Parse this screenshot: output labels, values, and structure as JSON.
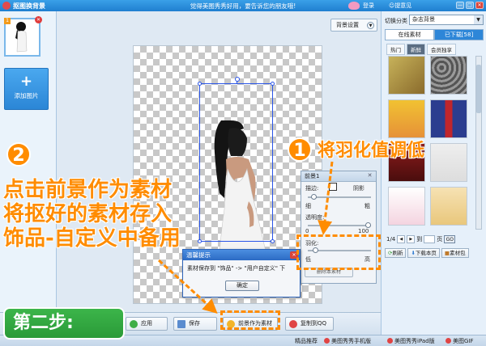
{
  "window": {
    "title": "抠图换背景",
    "slogan": "觉得美图秀秀好用，要告诉您的朋友哦!",
    "login": "登录",
    "about": "提意见",
    "min": "—",
    "max": "□",
    "close": "✕"
  },
  "left_panel": {
    "thumb_index": "1",
    "thumb_delete": "✕",
    "add_icon": "+",
    "add_label": "添加图片"
  },
  "canvas_toolbar": {
    "bg_settings_label": "背景设置",
    "bg_settings_arrow": "▼"
  },
  "fg_panel": {
    "title": "前景1",
    "close": "✕",
    "stroke_label": "描边:",
    "shadow_label": "阴影",
    "thin_label": "细",
    "thick_label": "粗",
    "opacity_label": "透明度:",
    "opacity_low": "0",
    "opacity_high": "100",
    "opacity_value": 1.0,
    "feather_label": "羽化:",
    "feather_low": "低",
    "feather_high": "高",
    "feather_value": 0.08,
    "stroke_value": 0.05,
    "delete_button": "删除本素材"
  },
  "dialog": {
    "title": "温馨提示",
    "message": "素材保存到 \"饰品\" -> \"用户自定义\" 下",
    "ok": "确定",
    "close": "✕"
  },
  "bottom_bar": {
    "apply": "应用",
    "save": "保存",
    "as_material": "前景作为素材",
    "copy_qq": "复制到QQ"
  },
  "right_panel": {
    "category_label": "切换分类",
    "category_value": "杂志背景",
    "tabs": [
      "在线素材",
      "已下载[58]"
    ],
    "subtabs": [
      "热门",
      "新鲜",
      "会员独享"
    ],
    "page_text": "1/4",
    "page_prefix": "到",
    "page_suffix": "页",
    "go": "GO",
    "buttons": [
      "刷新",
      "下载本页",
      "素材包"
    ]
  },
  "statusbar": {
    "items": [
      "精品推荐",
      "美图秀秀手机版",
      "美图秀秀iPad版",
      "美图GIF"
    ]
  },
  "annotations": {
    "step1_num": "1",
    "step1_text": "将羽化值调低",
    "step2_num": "2",
    "step2_line1": "点击前景作为素材",
    "step2_line2": "将抠好的素材存入",
    "step2_line3": "饰品-自定义中备用",
    "step_badge": "第二步:"
  },
  "colors": {
    "accent": "#ff8c00",
    "selection": "#2a55e8",
    "badge_green": "#3cb54a",
    "titlebar": "#2a8fdd"
  }
}
